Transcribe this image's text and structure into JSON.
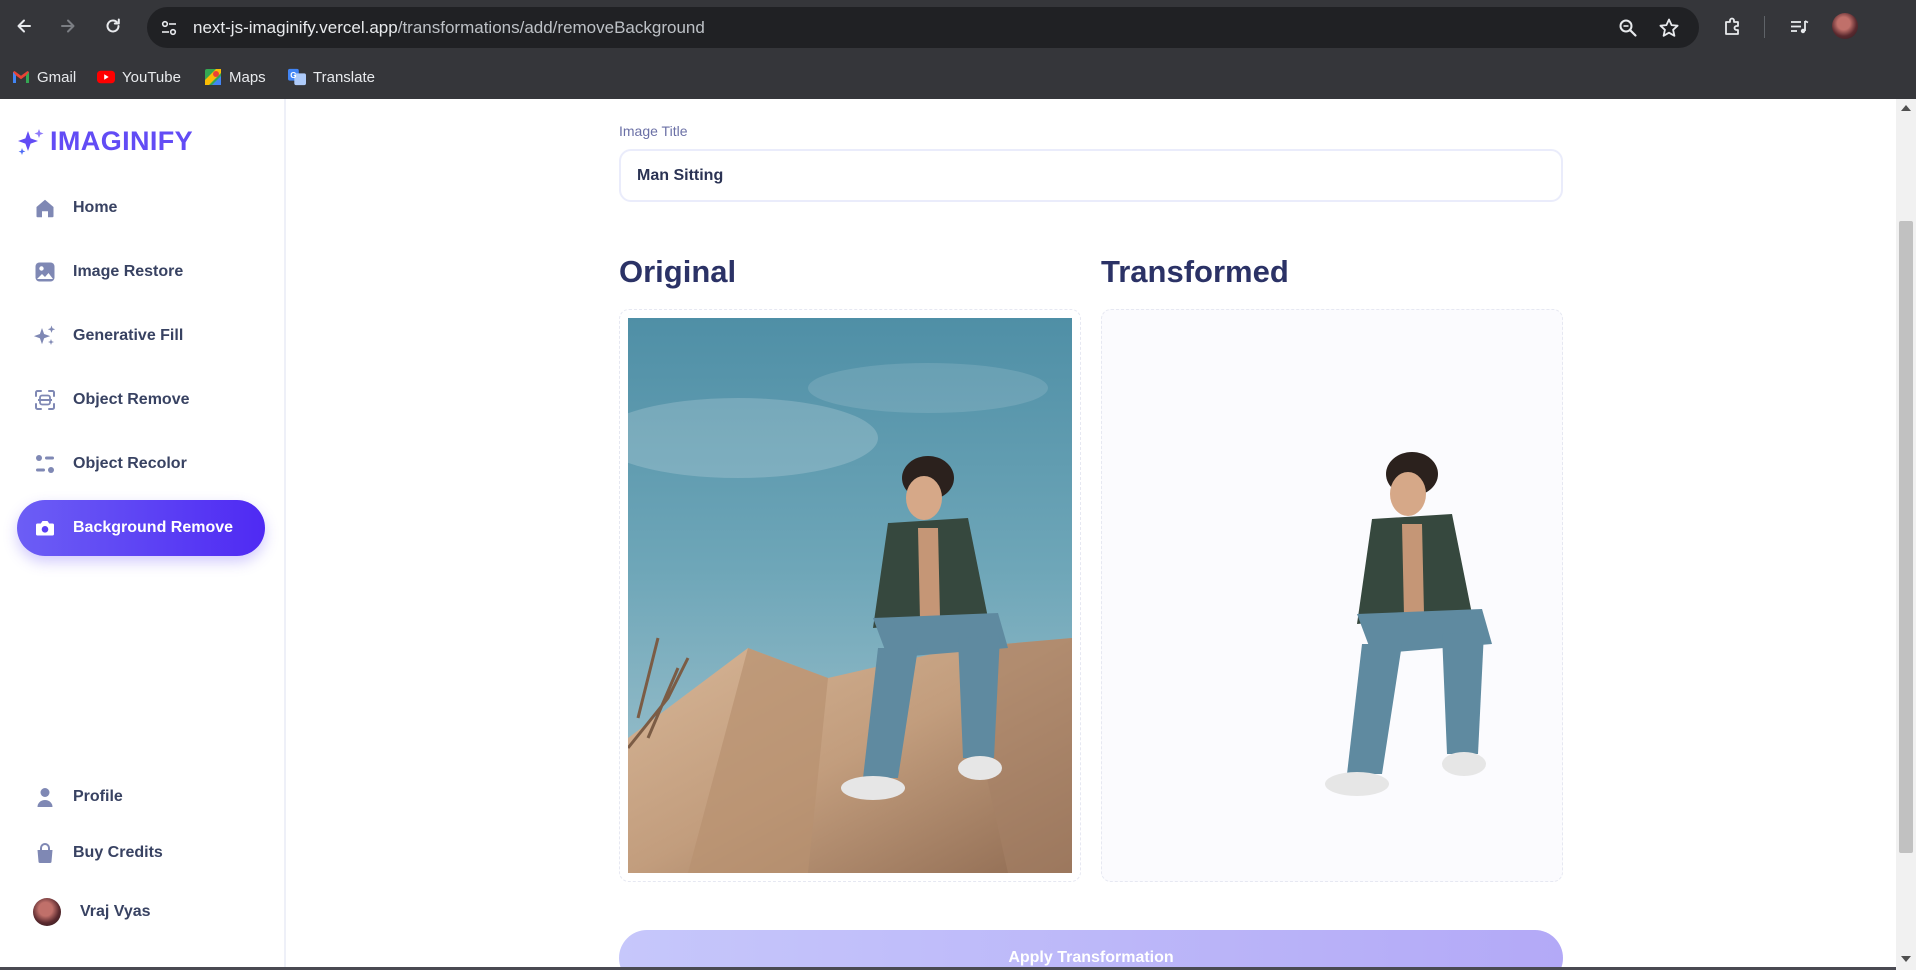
{
  "browser": {
    "url_host": "next-js-imaginify.vercel.app",
    "url_path": "/transformations/add/removeBackground",
    "bookmarks": [
      {
        "label": "Gmail",
        "icon": "gmail-icon"
      },
      {
        "label": "YouTube",
        "icon": "youtube-icon"
      },
      {
        "label": "Maps",
        "icon": "maps-icon"
      },
      {
        "label": "Translate",
        "icon": "translate-icon"
      }
    ]
  },
  "app": {
    "logo_text": "IMAGINIFY",
    "brand_color": "#624cf5"
  },
  "sidebar": {
    "items": [
      {
        "label": "Home",
        "icon": "home-icon"
      },
      {
        "label": "Image Restore",
        "icon": "image-icon"
      },
      {
        "label": "Generative Fill",
        "icon": "sparkles-icon"
      },
      {
        "label": "Object Remove",
        "icon": "scan-icon"
      },
      {
        "label": "Object Recolor",
        "icon": "filter-icon"
      },
      {
        "label": "Background Remove",
        "icon": "camera-icon",
        "active": true
      }
    ],
    "bottom_items": [
      {
        "label": "Profile",
        "icon": "profile-icon"
      },
      {
        "label": "Buy Credits",
        "icon": "bag-icon"
      }
    ],
    "user_name": "Vraj Vyas"
  },
  "form": {
    "title_label": "Image Title",
    "title_value": "Man Sitting",
    "original_heading": "Original",
    "transformed_heading": "Transformed",
    "apply_label": "Apply Transformation"
  }
}
